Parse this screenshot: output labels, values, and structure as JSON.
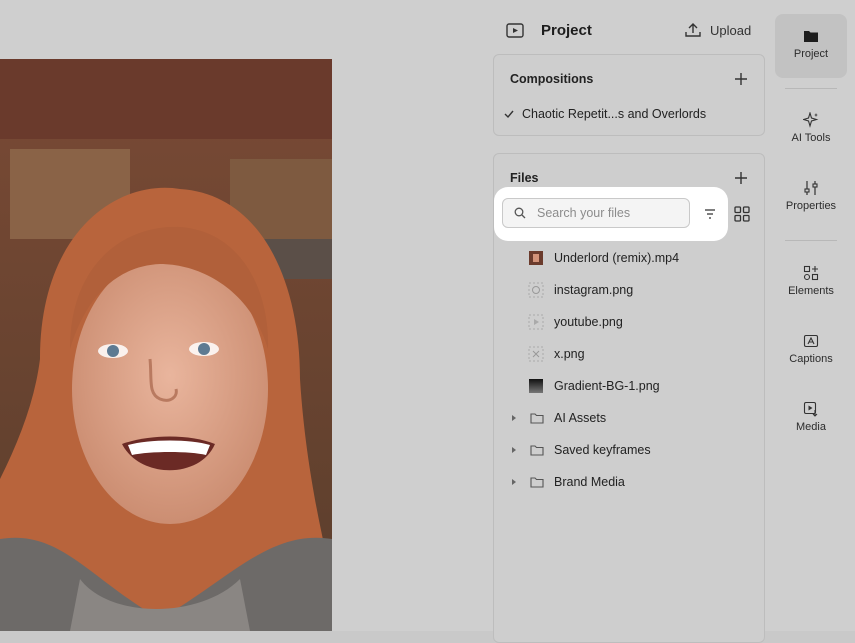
{
  "panel": {
    "title": "Project",
    "upload_label": "Upload"
  },
  "compositions": {
    "title": "Compositions",
    "items": [
      {
        "label": "Chaotic Repetit...s and Overlords",
        "selected": true
      }
    ]
  },
  "files": {
    "title": "Files",
    "search_placeholder": "Search your files",
    "items": [
      {
        "label": "Underlord (remix).mp4",
        "type": "video"
      },
      {
        "label": "instagram.png",
        "type": "image"
      },
      {
        "label": "youtube.png",
        "type": "image"
      },
      {
        "label": "x.png",
        "type": "image"
      },
      {
        "label": "Gradient-BG-1.png",
        "type": "gradient"
      }
    ],
    "folders": [
      {
        "label": "AI Assets"
      },
      {
        "label": "Saved keyframes"
      },
      {
        "label": "Brand Media"
      }
    ]
  },
  "rail": {
    "items": [
      {
        "label": "Project",
        "icon": "folder-icon",
        "active": true
      },
      {
        "label": "AI Tools",
        "icon": "sparkle-icon"
      },
      {
        "label": "Properties",
        "icon": "sliders-icon"
      },
      {
        "label": "Elements",
        "icon": "elements-icon"
      },
      {
        "label": "Captions",
        "icon": "captions-icon"
      },
      {
        "label": "Media",
        "icon": "media-icon"
      }
    ]
  },
  "colors": {
    "accent": "#1d1d1d",
    "overlay": "#cfcfcf",
    "highlight": "#ffffff"
  }
}
